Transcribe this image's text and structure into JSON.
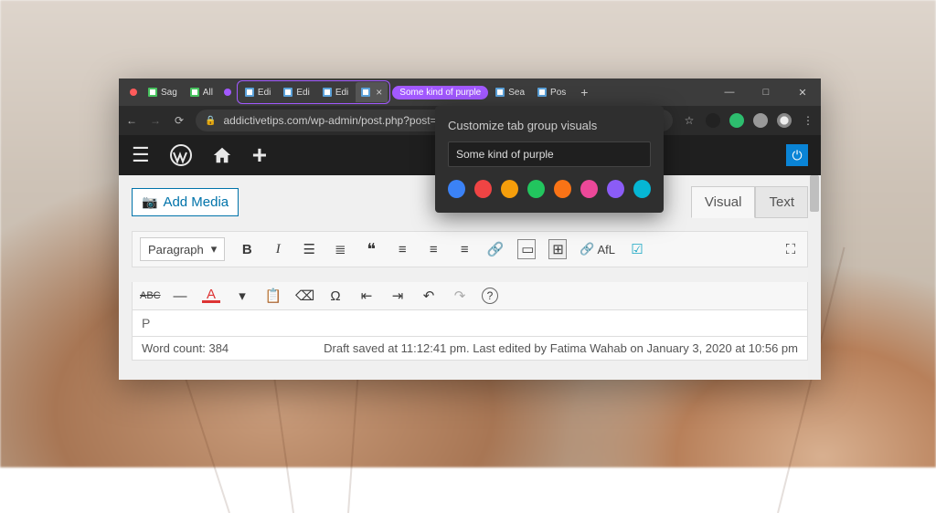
{
  "browser": {
    "tabs": [
      {
        "label": "Sag",
        "favicon": "#47c25e"
      },
      {
        "label": "All",
        "favicon": "#47c25e"
      },
      {
        "label": "Edi",
        "favicon": "#5aa0d8"
      },
      {
        "label": "Edi",
        "favicon": "#5aa0d8"
      },
      {
        "label": "Edi",
        "favicon": "#5aa0d8"
      },
      {
        "label": "",
        "favicon": "#5aa0d8",
        "active": true
      },
      {
        "label": "Sea",
        "favicon": "#5aa0d8"
      },
      {
        "label": "Pos",
        "favicon": "#5aa0d8"
      }
    ],
    "group_dots": [
      "#ff5b5b",
      "#a259ff"
    ],
    "group_pill": "Some kind of purple",
    "url": "addictivetips.com/wp-admin/post.php?post=",
    "window_controls": {
      "min": "—",
      "max": "□",
      "close": "✕"
    }
  },
  "popup": {
    "title": "Customize tab group visuals",
    "value": "Some kind of purple",
    "colors": [
      "#3b82f6",
      "#ef4444",
      "#f59e0b",
      "#22c55e",
      "#f97316",
      "#ec4899",
      "#8b5cf6",
      "#06b6d4"
    ]
  },
  "editor": {
    "add_media": "Add Media",
    "view_tabs": {
      "visual": "Visual",
      "text": "Text"
    },
    "format_select": "Paragraph",
    "afl_label": "AfL",
    "path": "P",
    "wordcount_label": "Word count: 384",
    "status": "Draft saved at 11:12:41 pm. Last edited by Fatima Wahab on January 3, 2020 at 10:56 pm"
  }
}
